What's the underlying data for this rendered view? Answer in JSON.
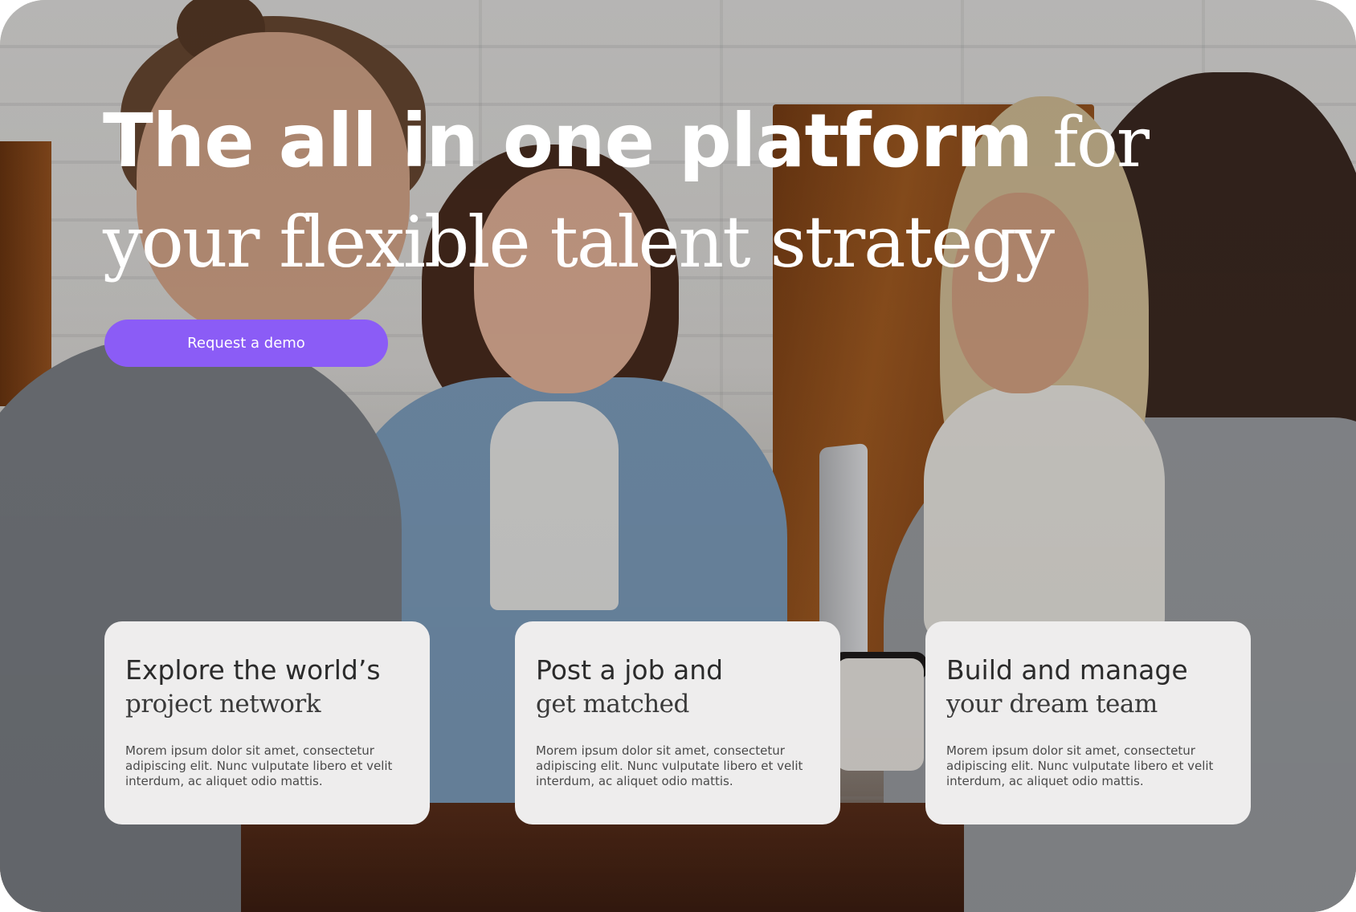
{
  "hero": {
    "headline_bold": "The all in one platform",
    "headline_serif_end": " for",
    "headline_line2": "your flexible talent strategy",
    "cta_label": "Request a demo",
    "accent_color": "#8b5cf6",
    "background_image": "photo-four-people-smiling-at-table"
  },
  "cards": [
    {
      "title_sans": "Explore the world’s",
      "title_serif": "project network",
      "body": "Morem ipsum dolor sit amet, consectetur adipiscing elit. Nunc vulputate libero et velit interdum, ac aliquet odio mattis."
    },
    {
      "title_sans": "Post a job and",
      "title_serif": "get matched",
      "body": "Morem ipsum dolor sit amet, consectetur adipiscing elit. Nunc vulputate libero et velit interdum, ac aliquet odio mattis."
    },
    {
      "title_sans": "Build and manage",
      "title_serif": "your dream team",
      "body": "Morem ipsum dolor sit amet, consectetur adipiscing elit. Nunc vulputate libero et velit interdum, ac aliquet odio mattis."
    }
  ]
}
